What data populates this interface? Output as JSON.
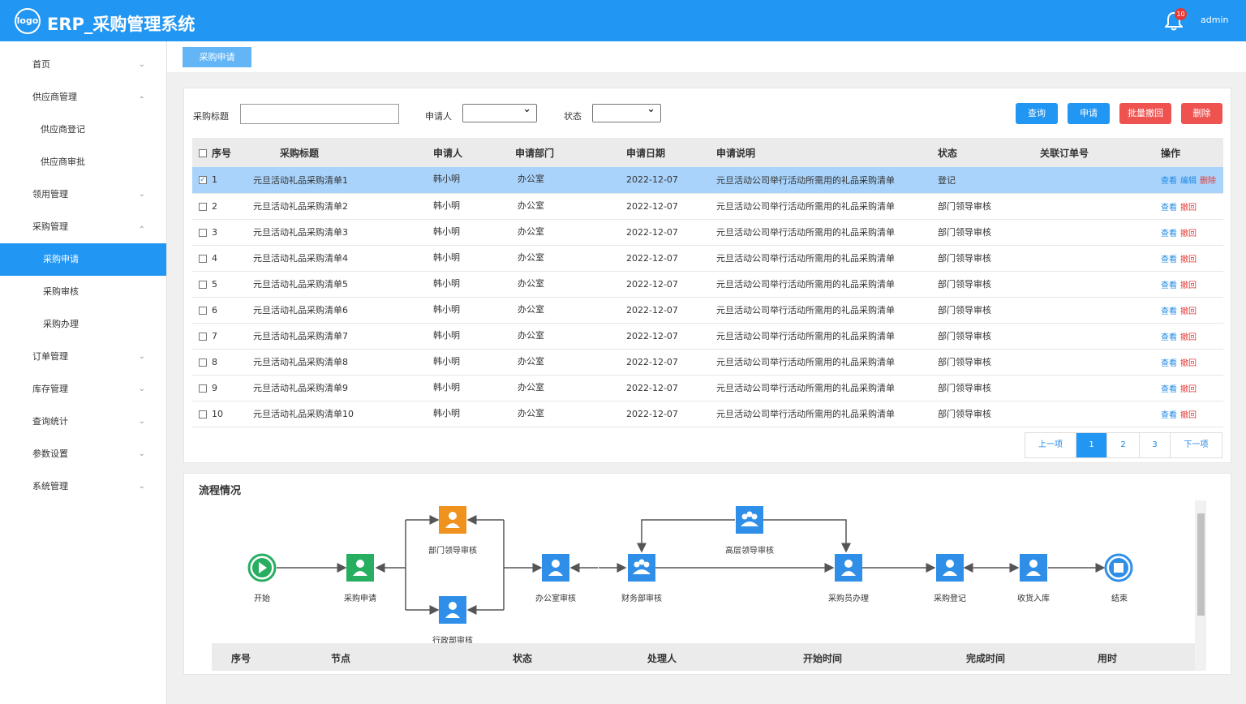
{
  "header": {
    "logo": "logo",
    "title": "ERP_采购管理系统",
    "badge": "10",
    "user": "admin"
  },
  "sidebar": {
    "items": [
      {
        "label": "首页"
      },
      {
        "label": "供应商管理"
      },
      {
        "label": "供应商登记"
      },
      {
        "label": "供应商审批"
      },
      {
        "label": "领用管理"
      },
      {
        "label": "采购管理"
      },
      {
        "label": "采购申请"
      },
      {
        "label": "采购审核"
      },
      {
        "label": "采购办理"
      },
      {
        "label": "订单管理"
      },
      {
        "label": "库存管理"
      },
      {
        "label": "查询统计"
      },
      {
        "label": "参数设置"
      },
      {
        "label": "系统管理"
      }
    ]
  },
  "tab": {
    "label": "采购申请"
  },
  "search": {
    "title_label": "采购标题",
    "applicant_label": "申请人",
    "status_label": "状态",
    "query_btn": "查询",
    "apply_btn": "申请",
    "batch_btn": "批量撤回",
    "delete_btn": "删除"
  },
  "table": {
    "headers": [
      "序号",
      "采购标题",
      "申请人",
      "申请部门",
      "申请日期",
      "申请说明",
      "状态",
      "关联订单号",
      "操作"
    ],
    "rows": [
      {
        "no": "1",
        "title": "元旦活动礼品采购清单1",
        "applicant": "韩小明",
        "dept": "办公室",
        "date": "2022-12-07",
        "desc": "元旦活动公司举行活动所需用的礼品采购清单",
        "status": "登记",
        "op1": "查看",
        "op2": "编辑",
        "op3": "删除"
      },
      {
        "no": "2",
        "title": "元旦活动礼品采购清单2",
        "applicant": "韩小明",
        "dept": "办公室",
        "date": "2022-12-07",
        "desc": "元旦活动公司举行活动所需用的礼品采购清单",
        "status": "部门领导审核",
        "op1": "查看",
        "op2": "撤回"
      },
      {
        "no": "3",
        "title": "元旦活动礼品采购清单3",
        "applicant": "韩小明",
        "dept": "办公室",
        "date": "2022-12-07",
        "desc": "元旦活动公司举行活动所需用的礼品采购清单",
        "status": "部门领导审核",
        "op1": "查看",
        "op2": "撤回"
      },
      {
        "no": "4",
        "title": "元旦活动礼品采购清单4",
        "applicant": "韩小明",
        "dept": "办公室",
        "date": "2022-12-07",
        "desc": "元旦活动公司举行活动所需用的礼品采购清单",
        "status": "部门领导审核",
        "op1": "查看",
        "op2": "撤回"
      },
      {
        "no": "5",
        "title": "元旦活动礼品采购清单5",
        "applicant": "韩小明",
        "dept": "办公室",
        "date": "2022-12-07",
        "desc": "元旦活动公司举行活动所需用的礼品采购清单",
        "status": "部门领导审核",
        "op1": "查看",
        "op2": "撤回"
      },
      {
        "no": "6",
        "title": "元旦活动礼品采购清单6",
        "applicant": "韩小明",
        "dept": "办公室",
        "date": "2022-12-07",
        "desc": "元旦活动公司举行活动所需用的礼品采购清单",
        "status": "部门领导审核",
        "op1": "查看",
        "op2": "撤回"
      },
      {
        "no": "7",
        "title": "元旦活动礼品采购清单7",
        "applicant": "韩小明",
        "dept": "办公室",
        "date": "2022-12-07",
        "desc": "元旦活动公司举行活动所需用的礼品采购清单",
        "status": "部门领导审核",
        "op1": "查看",
        "op2": "撤回"
      },
      {
        "no": "8",
        "title": "元旦活动礼品采购清单8",
        "applicant": "韩小明",
        "dept": "办公室",
        "date": "2022-12-07",
        "desc": "元旦活动公司举行活动所需用的礼品采购清单",
        "status": "部门领导审核",
        "op1": "查看",
        "op2": "撤回"
      },
      {
        "no": "9",
        "title": "元旦活动礼品采购清单9",
        "applicant": "韩小明",
        "dept": "办公室",
        "date": "2022-12-07",
        "desc": "元旦活动公司举行活动所需用的礼品采购清单",
        "status": "部门领导审核",
        "op1": "查看",
        "op2": "撤回"
      },
      {
        "no": "10",
        "title": "元旦活动礼品采购清单10",
        "applicant": "韩小明",
        "dept": "办公室",
        "date": "2022-12-07",
        "desc": "元旦活动公司举行活动所需用的礼品采购清单",
        "status": "部门领导审核",
        "op1": "查看",
        "op2": "撤回"
      }
    ]
  },
  "pager": {
    "prev": "上一项",
    "p1": "1",
    "p2": "2",
    "p3": "3",
    "next": "下一项"
  },
  "flow": {
    "title": "流程情况",
    "nodes": {
      "start": "开始",
      "apply": "采购申请",
      "dept": "部门领导审核",
      "admin": "行政部审核",
      "office": "办公室审核",
      "finance": "财务部审核",
      "senior": "高层领导审核",
      "buyer": "采购员办理",
      "register": "采购登记",
      "stock": "收货入库",
      "end": "结束"
    },
    "colors": {
      "green": "#27ae60",
      "orange": "#f0921e",
      "blue": "#2f8fe8"
    },
    "headers": [
      "序号",
      "节点",
      "状态",
      "处理人",
      "开始时间",
      "完成时间",
      "用时"
    ]
  }
}
